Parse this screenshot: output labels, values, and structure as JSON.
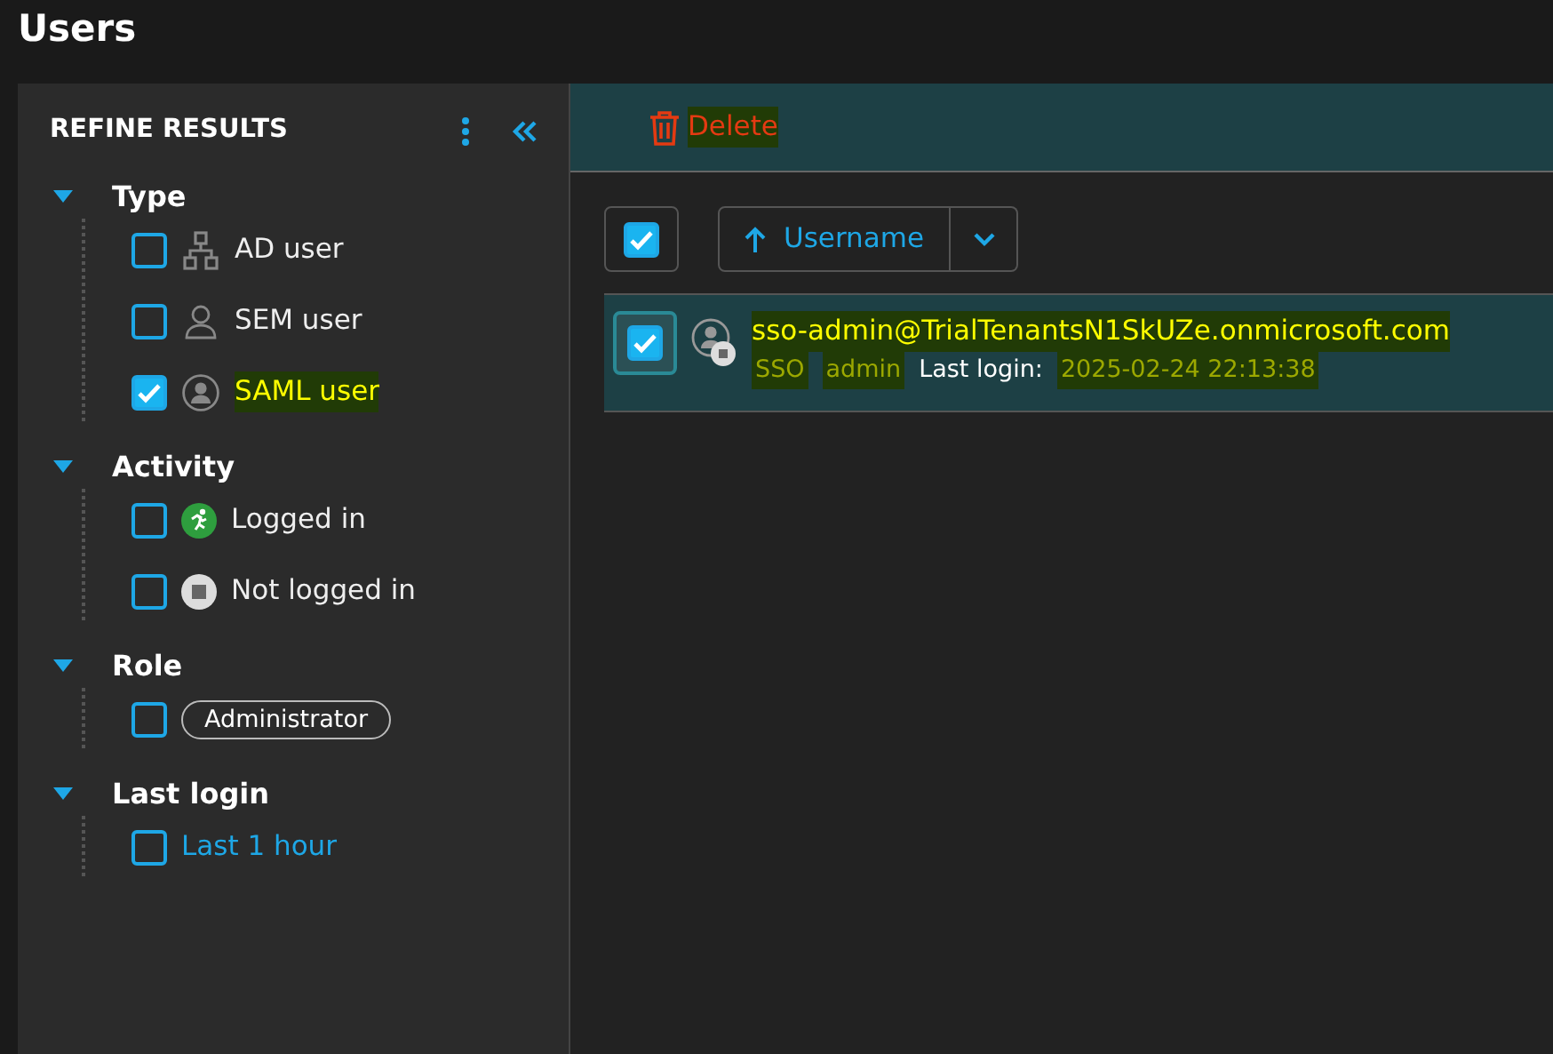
{
  "page_title": "Users",
  "sidebar": {
    "title": "REFINE RESULTS",
    "groups": [
      {
        "label": "Type",
        "expanded": true,
        "options": [
          {
            "kind": "network",
            "label": "AD user",
            "checked": false,
            "highlighted": false
          },
          {
            "kind": "person",
            "label": "SEM user",
            "checked": false,
            "highlighted": false
          },
          {
            "kind": "person-circle",
            "label": "SAML user",
            "checked": true,
            "highlighted": true
          }
        ]
      },
      {
        "label": "Activity",
        "expanded": true,
        "options": [
          {
            "kind": "running",
            "label": "Logged in",
            "checked": false,
            "highlighted": false
          },
          {
            "kind": "stop",
            "label": "Not logged in",
            "checked": false,
            "highlighted": false
          }
        ]
      },
      {
        "label": "Role",
        "expanded": true,
        "options": [
          {
            "kind": "tag",
            "label": "Administrator",
            "checked": false,
            "highlighted": false
          }
        ]
      },
      {
        "label": "Last login",
        "expanded": true,
        "options": [
          {
            "kind": "link",
            "label": "Last 1 hour",
            "checked": false,
            "highlighted": false
          }
        ]
      }
    ]
  },
  "actions": [
    {
      "label": "Delete",
      "highlighted": true
    }
  ],
  "toolbar": {
    "select_all_checked": true,
    "sort_label": "Username"
  },
  "users": [
    {
      "selected": true,
      "username": "sso-admin@TrialTenantsN1SkUZe.onmicrosoft.com",
      "highlighted": true,
      "tags": [
        {
          "text": "SSO",
          "highlighted": true
        },
        {
          "text": "admin",
          "highlighted": true
        }
      ],
      "last_login_label": "Last login:",
      "last_login": "2025-02-24 22:13:38",
      "last_login_highlighted": true
    }
  ]
}
